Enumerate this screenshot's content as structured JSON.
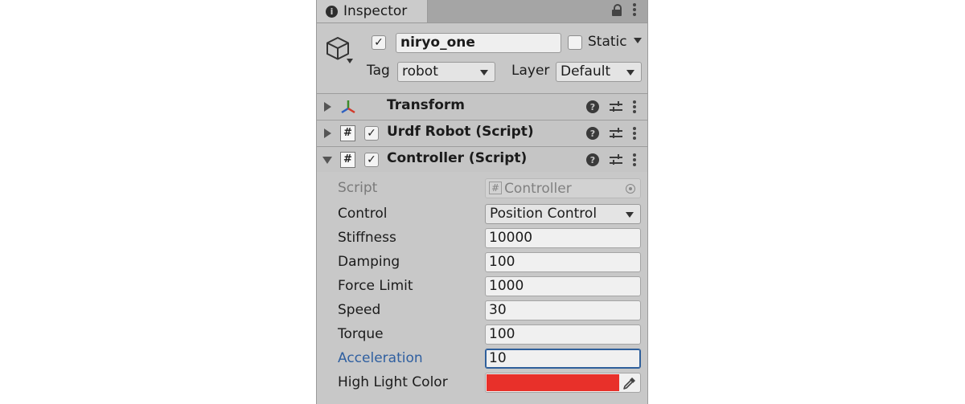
{
  "tab": {
    "title": "Inspector"
  },
  "header": {
    "object_name": "niryo_one",
    "active_checked": true,
    "static_label": "Static",
    "tag_label": "Tag",
    "tag_value": "robot",
    "layer_label": "Layer",
    "layer_value": "Default"
  },
  "components": [
    {
      "title": "Transform",
      "expanded": false
    },
    {
      "title": "Urdf Robot (Script)",
      "expanded": false,
      "enabled": true
    },
    {
      "title": "Controller (Script)",
      "expanded": true,
      "enabled": true
    }
  ],
  "controller": {
    "script_label": "Script",
    "script_value": "Controller",
    "control_label": "Control",
    "control_value": "Position Control",
    "stiffness_label": "Stiffness",
    "stiffness_value": "10000",
    "damping_label": "Damping",
    "damping_value": "100",
    "force_limit_label": "Force Limit",
    "force_limit_value": "1000",
    "speed_label": "Speed",
    "speed_value": "30",
    "torque_label": "Torque",
    "torque_value": "100",
    "acceleration_label": "Acceleration",
    "acceleration_value": "10",
    "highlight_label": "High Light Color",
    "highlight_color": "#e8302a"
  },
  "colors": {
    "panel_bg": "#c8c8c8",
    "focus_label": "#2f5fa0"
  },
  "icons": {
    "info": "info-icon",
    "lock": "lock-icon",
    "menu": "kebab-menu-icon",
    "gameobject": "cube-icon",
    "transform": "transform-axes-icon",
    "script": "script-hash-icon",
    "help": "help-icon",
    "presets": "sliders-icon",
    "picker": "eyedropper-icon"
  }
}
